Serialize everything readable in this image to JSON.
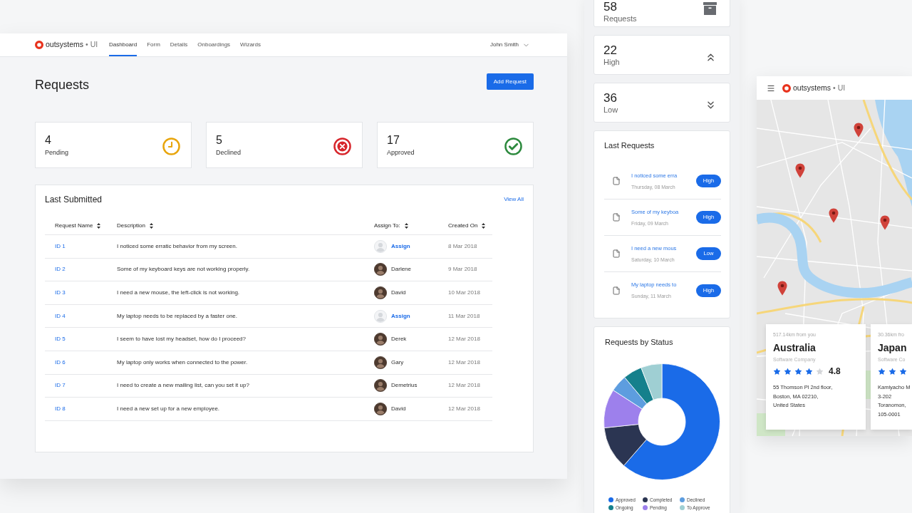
{
  "dashboard": {
    "header": {
      "logo_name": "outsystems",
      "logo_suffix": "• UI",
      "nav": [
        {
          "label": "Dashboard",
          "selected": true
        },
        {
          "label": "Form",
          "selected": false
        },
        {
          "label": "Details",
          "selected": false
        },
        {
          "label": "Onboardings",
          "selected": false
        },
        {
          "label": "Wizards",
          "selected": false
        }
      ],
      "user": "John Smith"
    },
    "title": "Requests",
    "add_button": "Add Request",
    "stats": [
      {
        "kind": "pending",
        "value": "4",
        "label": "Pending"
      },
      {
        "kind": "declined",
        "value": "5",
        "label": "Declined"
      },
      {
        "kind": "approved",
        "value": "17",
        "label": "Approved"
      }
    ],
    "table_card": {
      "title": "Last Submitted",
      "view_all": "View All",
      "columns": [
        "Request Name",
        "Description",
        "Assign To:",
        "Created On"
      ],
      "rows": [
        {
          "id": "ID 1",
          "description": "I noticed some erratic behavior from my screen.",
          "assignee": {
            "kind": "unassigned",
            "text": "Assign"
          },
          "created": "8 Mar 2018"
        },
        {
          "id": "ID 2",
          "description": "Some of my keyboard keys are not working properly.",
          "assignee": {
            "kind": "person",
            "text": "Darlene"
          },
          "created": "9 Mar 2018"
        },
        {
          "id": "ID 3",
          "description": "I need a new mouse, the left-click is not working.",
          "assignee": {
            "kind": "person",
            "text": "David"
          },
          "created": "10 Mar 2018"
        },
        {
          "id": "ID 4",
          "description": "My laptop needs to be replaced by a faster one.",
          "assignee": {
            "kind": "unassigned",
            "text": "Assign"
          },
          "created": "11 Mar 2018"
        },
        {
          "id": "ID 5",
          "description": "I seem to have lost my headset, how do I proceed?",
          "assignee": {
            "kind": "person",
            "text": "Derek"
          },
          "created": "12 Mar 2018"
        },
        {
          "id": "ID 6",
          "description": "My laptop only works when connected to the power.",
          "assignee": {
            "kind": "person",
            "text": "Gary"
          },
          "created": "12 Mar 2018"
        },
        {
          "id": "ID 7",
          "description": "I need to create a new mailing list, can you set it up?",
          "assignee": {
            "kind": "person",
            "text": "Demetrius"
          },
          "created": "12 Mar 2018"
        },
        {
          "id": "ID 8",
          "description": "I need a new set up for a new employee.",
          "assignee": {
            "kind": "person",
            "text": "David"
          },
          "created": "12 Mar 2018"
        }
      ]
    }
  },
  "mobile_summary": {
    "counters": [
      {
        "kind": "archive",
        "value": "58",
        "label": "Requests"
      },
      {
        "kind": "high",
        "value": "22",
        "label": "High"
      },
      {
        "kind": "low",
        "value": "36",
        "label": "Low"
      }
    ],
    "last_requests": {
      "title": "Last Requests",
      "items": [
        {
          "text": "I noticed some erra",
          "date": "Thursday, 08 March",
          "priority": "High"
        },
        {
          "text": "Some of my keyboa",
          "date": "Friday, 09 March",
          "priority": "High"
        },
        {
          "text": "I need a new mous",
          "date": "Saturday, 10 March",
          "priority": "Low"
        },
        {
          "text": "My laptop needs to",
          "date": "Sunday, 11 March",
          "priority": "High"
        }
      ]
    },
    "status_chart": {
      "title": "Requests by Status",
      "legend": [
        {
          "label": "Approved",
          "color": "#1a6be8"
        },
        {
          "label": "Completed",
          "color": "#2b3552"
        },
        {
          "label": "Declined",
          "color": "#5d9ddf"
        },
        {
          "label": "Ongoing",
          "color": "#15808c"
        },
        {
          "label": "Pending",
          "color": "#9d80ec"
        },
        {
          "label": "To Approve",
          "color": "#9fcfd3"
        }
      ]
    }
  },
  "map_app": {
    "logo_name": "outsystems",
    "logo_suffix": "• UI",
    "places": [
      {
        "distance": "517.14km from you",
        "name": "Australia",
        "category": "Software Company",
        "stars": 4,
        "rating": "4.8",
        "address": [
          "55 Thomson Pl 2nd floor,",
          "Boston, MA 02210,",
          "United States"
        ]
      },
      {
        "distance": "30.36km fro",
        "name": "Japan",
        "category": "Software Co",
        "stars": 3,
        "address": [
          "Kamiyacho M",
          "3-202",
          "Toranomon,",
          "105-0001"
        ]
      }
    ]
  }
}
